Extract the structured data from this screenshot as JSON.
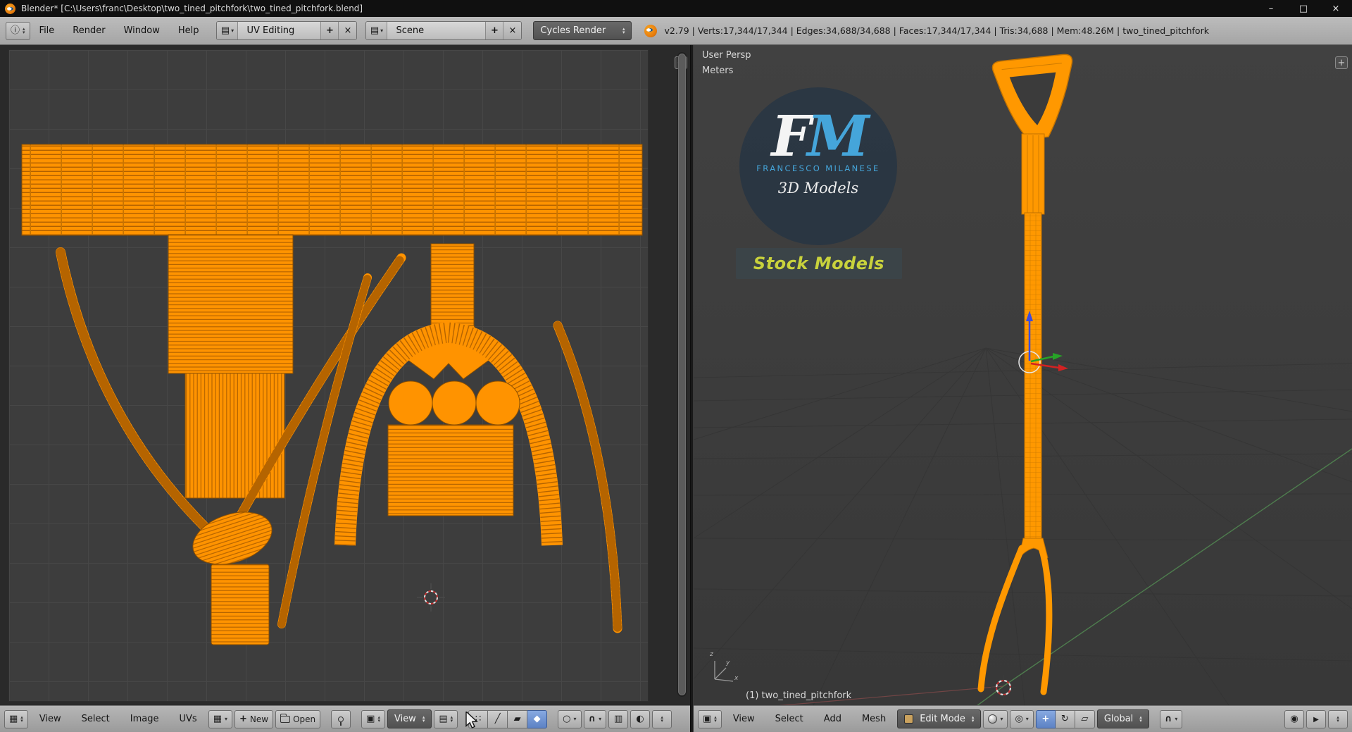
{
  "titlebar": {
    "title": "Blender* [C:\\Users\\franc\\Desktop\\two_tined_pitchfork\\two_tined_pitchfork.blend]",
    "minimize": "–",
    "maximize": "□",
    "close": "×"
  },
  "infobar": {
    "menus": [
      "File",
      "Render",
      "Window",
      "Help"
    ],
    "layout_value": "UV Editing",
    "scene_value": "Scene",
    "engine_value": "Cycles Render",
    "stats": "v2.79 | Verts:17,344/17,344 | Edges:34,688/34,688 | Faces:17,344/17,344 | Tris:34,688 | Mem:48.26M | two_tined_pitchfork"
  },
  "uv": {
    "header": {
      "menus": [
        "View",
        "Select",
        "Image",
        "UVs"
      ],
      "new_label": "New",
      "open_label": "Open",
      "view_value": "View"
    }
  },
  "v3d": {
    "view_label": "User Persp",
    "units_label": "Meters",
    "object_info": "(1) two_tined_pitchfork",
    "axis": {
      "x": "x",
      "y": "y",
      "z": "z"
    },
    "header": {
      "menus": [
        "View",
        "Select",
        "Add",
        "Mesh"
      ],
      "mode_value": "Edit Mode",
      "orientation_value": "Global"
    },
    "watermark": {
      "f": "F",
      "m": "M",
      "name": "FRANCESCO MILANESE",
      "models_line": "3D Models",
      "stock_line": "Stock Models"
    }
  },
  "colors": {
    "selection_orange": "#ff9300",
    "logo_blue": "#45a5da",
    "stock_green": "#c9d23c",
    "header_gray": "#b0b0b0"
  }
}
